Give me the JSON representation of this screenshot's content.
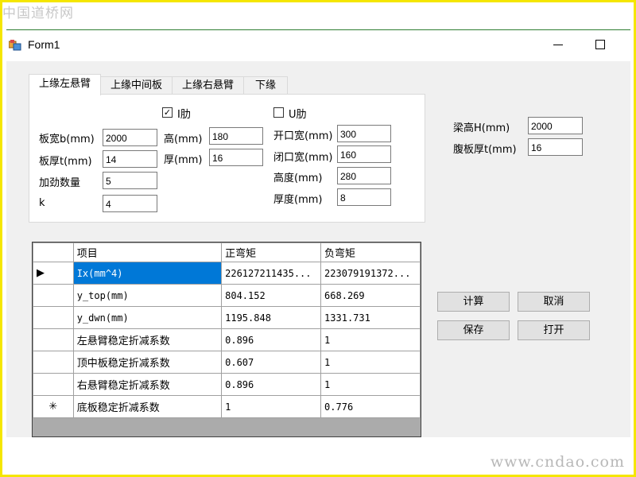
{
  "watermark": {
    "top": "中国道桥网",
    "bottom": "www.cndao.com"
  },
  "window": {
    "title": "Form1"
  },
  "tabs": [
    "上缘左悬臂",
    "上缘中间板",
    "上缘右悬臂",
    "下缘"
  ],
  "panel": {
    "board_width": {
      "label": "板宽b(mm)",
      "value": "2000"
    },
    "board_thick": {
      "label": "板厚t(mm)",
      "value": "14"
    },
    "stiff_count": {
      "label": "加劲数量",
      "value": "5"
    },
    "k": {
      "label": "k",
      "value": "4"
    },
    "i_rib": {
      "label": "I肋",
      "checked": true
    },
    "i_height": {
      "label": "高(mm)",
      "value": "180"
    },
    "i_thick": {
      "label": "厚(mm)",
      "value": "16"
    },
    "u_rib": {
      "label": "U肋",
      "checked": false
    },
    "u_open": {
      "label": "开口宽(mm)",
      "value": "300"
    },
    "u_close": {
      "label": "闭口宽(mm)",
      "value": "160"
    },
    "u_height": {
      "label": "高度(mm)",
      "value": "280"
    },
    "u_thick": {
      "label": "厚度(mm)",
      "value": "8"
    }
  },
  "beam": {
    "height": {
      "label": "梁高H(mm)",
      "value": "2000"
    },
    "web": {
      "label": "腹板厚t(mm)",
      "value": "16"
    }
  },
  "grid": {
    "columns": [
      "项目",
      "正弯矩",
      "负弯矩"
    ],
    "rows": [
      {
        "marker": "▶",
        "item": "Ix(mm^4)",
        "pos": "226127211435...",
        "neg": "223079191372..."
      },
      {
        "marker": "",
        "item": "y_top(mm)",
        "pos": "804.152",
        "neg": "668.269"
      },
      {
        "marker": "",
        "item": "y_dwn(mm)",
        "pos": "1195.848",
        "neg": "1331.731"
      },
      {
        "marker": "",
        "item": "左悬臂稳定折减系数",
        "pos": "0.896",
        "neg": "1"
      },
      {
        "marker": "",
        "item": "顶中板稳定折减系数",
        "pos": "0.607",
        "neg": "1"
      },
      {
        "marker": "",
        "item": "右悬臂稳定折减系数",
        "pos": "0.896",
        "neg": "1"
      },
      {
        "marker": "✳",
        "item": "底板稳定折减系数",
        "pos": "1",
        "neg": "0.776"
      }
    ]
  },
  "buttons": {
    "calc": "计算",
    "cancel": "取消",
    "save": "保存",
    "open": "打开"
  },
  "colors": {
    "selection": "#0078d7",
    "frame": "#f5e600",
    "client_bg": "#f0f0f0"
  }
}
